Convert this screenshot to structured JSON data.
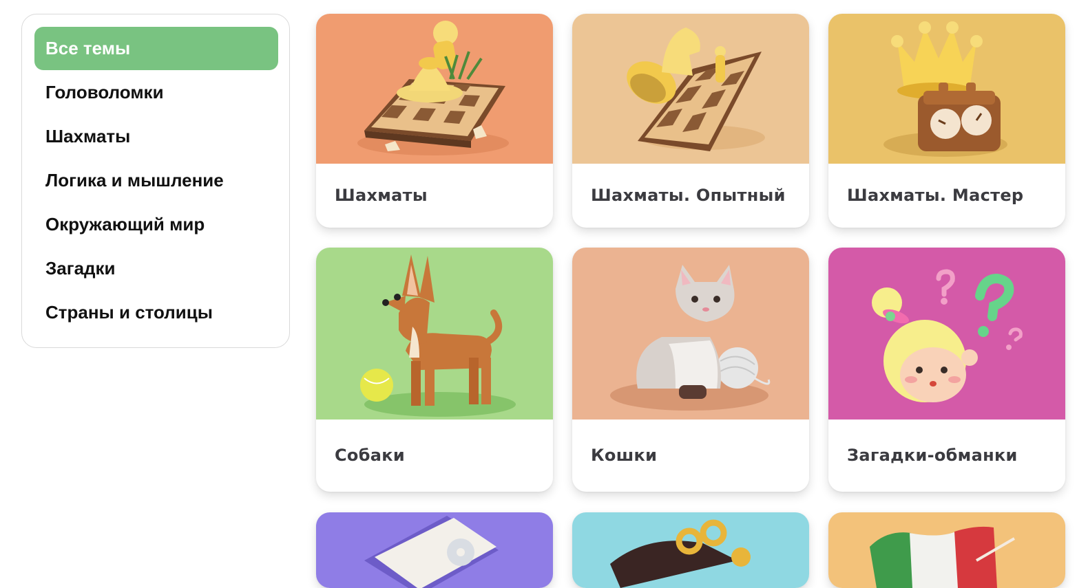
{
  "sidebar": {
    "items": [
      {
        "label": "Все темы",
        "active": true
      },
      {
        "label": "Головоломки"
      },
      {
        "label": "Шахматы"
      },
      {
        "label": "Логика и мышление"
      },
      {
        "label": "Окружающий мир"
      },
      {
        "label": "Загадки"
      },
      {
        "label": "Страны и столицы"
      }
    ]
  },
  "cards": [
    {
      "title": "Шахматы",
      "bg": "#f09c70",
      "icon": "chess-pawn-board-icon"
    },
    {
      "title": "Шахматы. Опытный",
      "bg": "#ecc595",
      "icon": "chess-knight-board-icon"
    },
    {
      "title": "Шахматы. Мастер",
      "bg": "#eac269",
      "icon": "crown-chess-clock-icon"
    },
    {
      "title": "Собаки",
      "bg": "#a8d98a",
      "icon": "dog-icon"
    },
    {
      "title": "Кошки",
      "bg": "#ebb391",
      "icon": "cat-icon"
    },
    {
      "title": "Загадки-обманки",
      "bg": "#d45aa8",
      "icon": "girl-question-icon"
    },
    {
      "title": "",
      "bg": "#8f7de6",
      "icon": "disc-icon"
    },
    {
      "title": "",
      "bg": "#8fd8e2",
      "icon": "hat-icon"
    },
    {
      "title": "",
      "bg": "#f3c27a",
      "icon": "italy-flag-icon"
    }
  ]
}
